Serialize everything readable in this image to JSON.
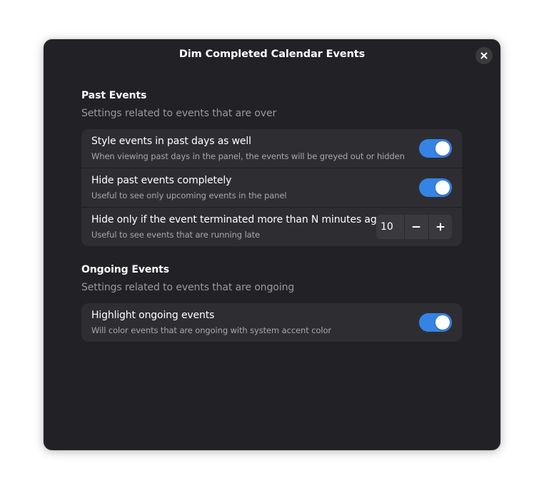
{
  "window": {
    "title": "Dim Completed Calendar Events",
    "close_icon": "close-icon"
  },
  "sections": {
    "past": {
      "title": "Past Events",
      "description": "Settings related to events that are over",
      "rows": [
        {
          "title": "Style events in past days as well",
          "subtitle": "When viewing past days in the panel, the events will be greyed out or hidden",
          "toggle_on": true
        },
        {
          "title": "Hide past events completely",
          "subtitle": "Useful to see only upcoming events in the panel",
          "toggle_on": true
        },
        {
          "title": "Hide only if the event terminated more than N minutes ago",
          "subtitle": "Useful to see events that are running late",
          "spin_value": "10",
          "minus_icon": "minus-icon",
          "plus_icon": "plus-icon"
        }
      ]
    },
    "ongoing": {
      "title": "Ongoing Events",
      "description": "Settings related to events that are ongoing",
      "rows": [
        {
          "title": "Highlight ongoing events",
          "subtitle": "Will color events that are ongoing with system accent color",
          "toggle_on": true
        }
      ]
    }
  },
  "colors": {
    "accent": "#3584e4",
    "window_bg": "#222226",
    "card_bg": "#2e2e32"
  }
}
